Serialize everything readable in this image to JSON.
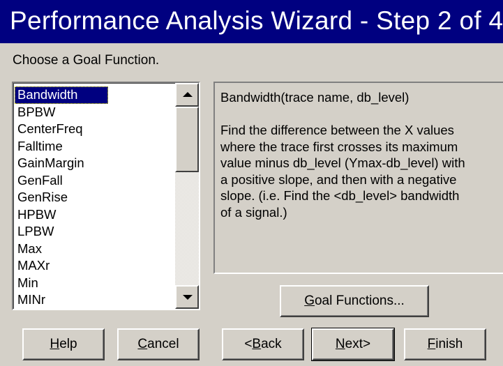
{
  "window": {
    "title": "Performance Analysis Wizard - Step 2 of 4"
  },
  "prompt": "Choose a Goal Function.",
  "goal_list": {
    "selected": "Bandwidth",
    "items": [
      "Bandwidth",
      "BPBW",
      "CenterFreq",
      "Falltime",
      "GainMargin",
      "GenFall",
      "GenRise",
      "HPBW",
      "LPBW",
      "Max",
      "MAXr",
      "Min",
      "MINr"
    ]
  },
  "description": {
    "signature": "Bandwidth(trace name, db_level)",
    "text": "Find the difference between the X values\nwhere the trace first crosses its maximum\nvalue minus db_level (Ymax-db_level) with\na positive slope, and then with a negative\nslope.   (i.e. Find the <db_level> bandwidth\nof a signal.)"
  },
  "buttons": {
    "goal_functions": {
      "mnemonic": "G",
      "rest": "oal Functions..."
    },
    "help": {
      "mnemonic": "H",
      "rest": "elp"
    },
    "cancel": {
      "mnemonic": "C",
      "rest": "ancel"
    },
    "back": {
      "prefix": "<",
      "mnemonic": "B",
      "rest": "ack"
    },
    "next": {
      "mnemonic": "N",
      "rest": "ext>"
    },
    "finish": {
      "mnemonic": "F",
      "rest": "inish"
    }
  },
  "icons": {
    "scroll_up": "triangle-up-icon",
    "scroll_down": "triangle-down-icon"
  },
  "colors": {
    "title_bar": "#000080",
    "face": "#d4d0c8",
    "selection": "#000080"
  }
}
